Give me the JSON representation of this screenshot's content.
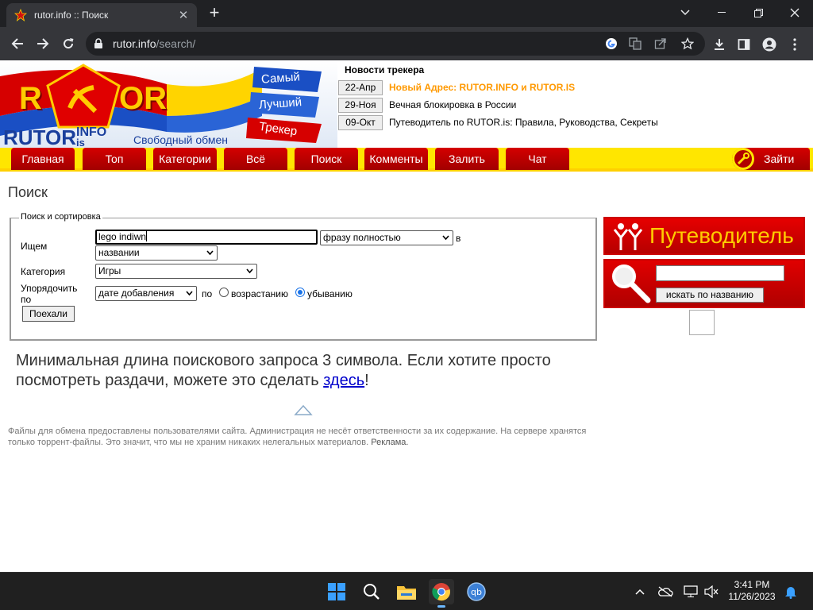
{
  "browser": {
    "tab_title": "rutor.info :: Поиск",
    "url_host": "rutor.info",
    "url_path": "/search/"
  },
  "site": {
    "logo": {
      "brand": "RUTOR",
      "domain1": "INFO",
      "domain2": "is",
      "slogan_top": "Самый",
      "slogan_mid": "Лучший",
      "slogan_bottom": "Трекер",
      "tagline": "Свободный обмен"
    },
    "news": {
      "title": "Новости трекера",
      "items": [
        {
          "date": "22-Апр",
          "text": "Новый Адрес: RUTOR.INFO и RUTOR.IS"
        },
        {
          "date": "29-Ноя",
          "text": "Вечная блокировка в России"
        },
        {
          "date": "09-Окт",
          "text": "Путеводитель по RUTOR.is: Правила, Руководства, Секреты"
        }
      ]
    },
    "menu": [
      {
        "label": "Главная"
      },
      {
        "label": "Топ"
      },
      {
        "label": "Категории"
      },
      {
        "label": "Всё"
      },
      {
        "label": "Поиск"
      },
      {
        "label": "Комменты"
      },
      {
        "label": "Залить"
      },
      {
        "label": "Чат"
      }
    ],
    "login_label": "Зайти"
  },
  "search_page": {
    "title": "Поиск",
    "legend": "Поиск и сортировка",
    "seek_label": "Ищем",
    "query_value": "lego indiwn",
    "mode_select": "фразу полностью",
    "in_label": "в",
    "where_select": "названии",
    "category_label": "Категория",
    "category_select": "Игры",
    "order_label": "Упорядочить по",
    "order_select": "дате добавления",
    "by_label": "по",
    "asc_label": "возрастанию",
    "desc_label": "убыванию",
    "desc_selected": true,
    "submit_label": "Поехали",
    "min_message": "Минимальная длина поискового запроса 3 символа. Если хотите просто посмотреть раздачи, можете это сделать",
    "min_link": "здесь",
    "min_end": "!",
    "footer_text": "Файлы для обмена предоставлены пользователями сайта. Администрация не несёт ответственности за их содержание. На сервере хранятся только торрент-файлы. Это значит, что мы не храним никаких нелегальных материалов.",
    "footer_ad": "Реклама."
  },
  "sidebar": {
    "guide_label": "Путеводитель",
    "search_button": "искать по названию"
  },
  "taskbar": {
    "time": "3:41 PM",
    "date": "11/26/2023"
  },
  "colors": {
    "menu_red": "#c40000",
    "menu_yellow": "#ffe600",
    "news_highlight": "#ff9900",
    "link": "#0000cc"
  }
}
